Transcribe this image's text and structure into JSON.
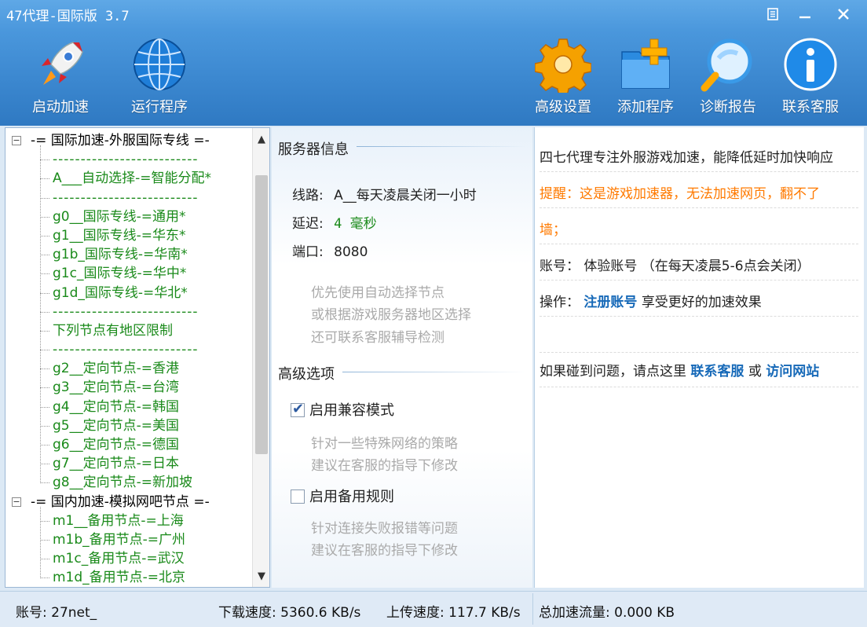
{
  "window": {
    "title": "47代理-国际版 3.7"
  },
  "toolbar": {
    "start": "启动加速",
    "run": "运行程序",
    "settings": "高级设置",
    "add": "添加程序",
    "diagnose": "诊断报告",
    "contact": "联系客服"
  },
  "tree": {
    "groups": [
      {
        "label": "-= 国际加速-外服国际专线 =-",
        "items": [
          "--------------------------",
          "A___自动选择-=智能分配*",
          "--------------------------",
          "g0__国际专线-=通用*",
          "g1__国际专线-=华东*",
          "g1b_国际专线-=华南*",
          "g1c_国际专线-=华中*",
          "g1d_国际专线-=华北*",
          "--------------------------",
          "下列节点有地区限制",
          "--------------------------",
          "g2__定向节点-=香港",
          "g3__定向节点-=台湾",
          "g4__定向节点-=韩国",
          "g5__定向节点-=美国",
          "g6__定向节点-=德国",
          "g7__定向节点-=日本",
          "g8__定向节点-=新加坡"
        ]
      },
      {
        "label": "-= 国内加速-模拟网吧节点 =-",
        "items": [
          "m1__备用节点-=上海",
          "m1b_备用节点-=广州",
          "m1c_备用节点-=武汉",
          "m1d_备用节点-=北京"
        ]
      }
    ]
  },
  "server": {
    "section_title": "服务器信息",
    "line_label": "线路:",
    "line_value": "A__每天凌晨关闭一小时",
    "latency_label": "延迟:",
    "latency_value": "4 毫秒",
    "port_label": "端口:",
    "port_value": "8080",
    "hint1": "优先使用自动选择节点",
    "hint2": "或根据游戏服务器地区选择",
    "hint3": "还可联系客服辅导检测"
  },
  "advanced": {
    "section_title": "高级选项",
    "compat_label": "启用兼容模式",
    "compat_checked": true,
    "compat_hint1": "针对一些特殊网络的策略",
    "compat_hint2": "建议在客服的指导下修改",
    "backup_label": "启用备用规则",
    "backup_checked": false,
    "backup_hint1": "针对连接失败报错等问题",
    "backup_hint2": "建议在客服的指导下修改"
  },
  "info": {
    "line1": "四七代理专注外服游戏加速，能降低延时加快响应",
    "tip1": "提醒：这是游戏加速器，无法加速网页，翻不了",
    "tip2": "墙；",
    "account_label": "账号：",
    "account_value": "体验账号 （在每天凌晨5-6点会关闭）",
    "op_label": "操作：",
    "register_link": "注册账号",
    "op_text": "享受更好的加速效果",
    "problem_text": "如果碰到问题，请点这里",
    "contact_link": "联系客服",
    "or_text": "或",
    "visit_link": "访问网站"
  },
  "status": {
    "account": "账号: 27net_",
    "download": "下载速度: 5360.6 KB/s",
    "upload": "上传速度: 117.7 KB/s",
    "total": "总加速流量: 0.000 KB"
  },
  "icons": {
    "start": "rocket-icon",
    "run": "globe-icon",
    "settings": "gear-icon",
    "add": "folder-add-icon",
    "diagnose": "magnifier-icon",
    "contact": "info-icon"
  }
}
